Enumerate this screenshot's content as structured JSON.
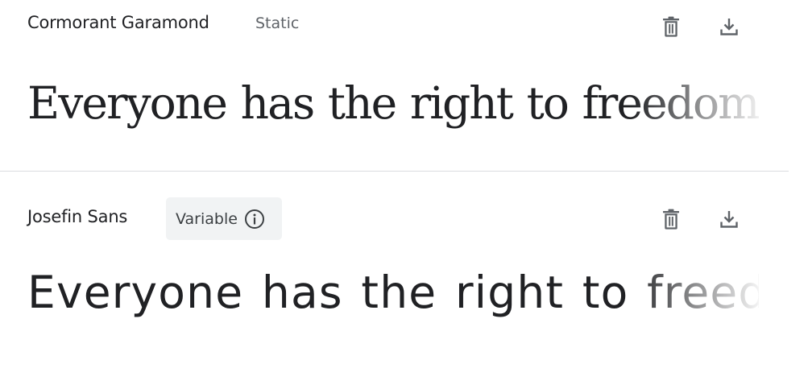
{
  "fonts": [
    {
      "name": "Cormorant Garamond",
      "type_label": "Static",
      "sample_text": "Everyone has the right to freedom of thought"
    },
    {
      "name": "Josefin Sans",
      "type_label": "Variable",
      "sample_text": "Everyone has the right to freedom"
    }
  ],
  "icons": {
    "delete": "trash-icon",
    "download": "download-icon",
    "info": "info-icon"
  },
  "colors": {
    "text": "#202124",
    "secondary_text": "#5f6368",
    "icon": "#5f6368",
    "divider": "#dadce0",
    "tag_background": "#f1f3f4"
  }
}
